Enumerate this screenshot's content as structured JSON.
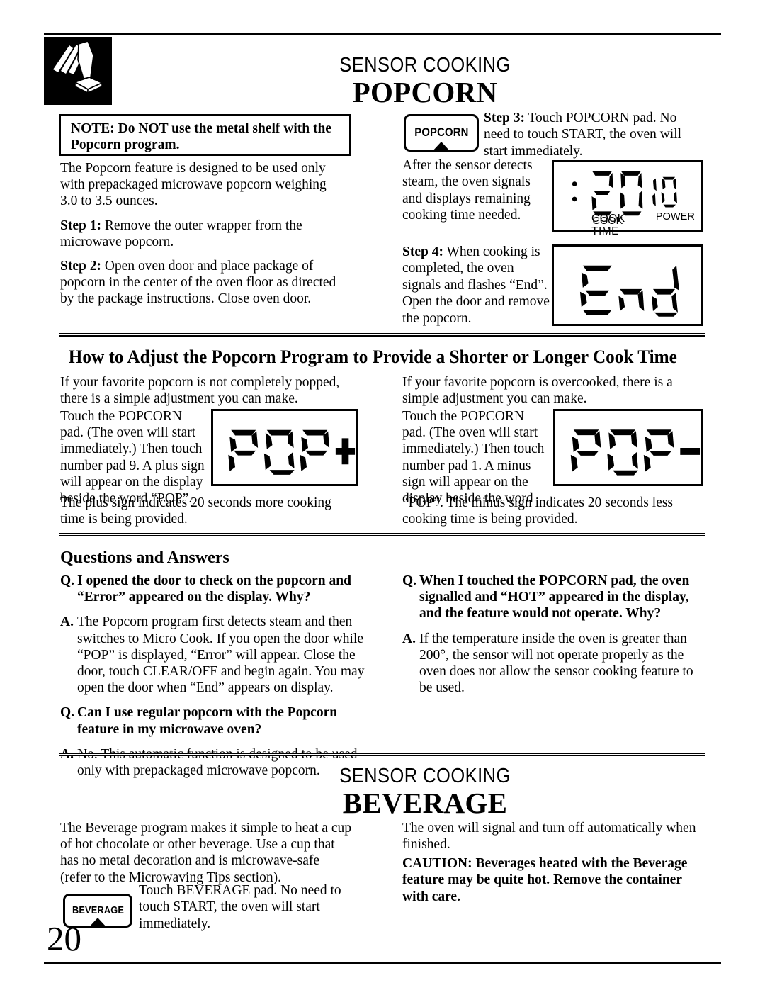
{
  "page": {
    "number": "20",
    "header_icon": "hand-press-icon"
  },
  "popcorn_section": {
    "eyebrow": "SENSOR COOKING",
    "title": "POPCORN",
    "note_line1": "NOTE: Do NOT use the metal shelf with the",
    "note_line2": "Popcorn program.",
    "intro": "The Popcorn feature is designed to be used only with prepackaged microwave popcorn weighing 3.0 to 3.5 ounces.",
    "step1": "Step 1:",
    "step1_text": " Remove the outer wrapper from the microwave popcorn.",
    "step2": "Step 2:",
    "step2_text": " Open oven door and place package of popcorn in the center of the oven floor as directed by the package instructions. Close oven door.",
    "pad_popcorn_label": "POPCORN",
    "step3": "Step 3:",
    "step3_text": " Touch POPCORN pad. No need to touch START, the oven will start immediately.",
    "sensor_detect_text": "After the sensor detects steam, the oven signals and displays remaining cooking time needed.",
    "step4": "Step 4:",
    "step4_text": " When cooking is completed, the oven signals and flashes “End”. Open the door and remove the popcorn."
  },
  "displays": {
    "cook_time": {
      "name": "cook-time-display",
      "big_digits": "20",
      "small_digits": "10",
      "power_label": "POWER",
      "cook_label": "COOK",
      "time_label": "TIME",
      "colon": ":"
    },
    "end": {
      "name": "end-display",
      "text": "End"
    },
    "pop_plus": {
      "name": "pop-plus-display",
      "text": "POP+"
    },
    "pop_minus": {
      "name": "pop-minus-display",
      "text": "POP-"
    }
  },
  "adjust_section": {
    "heading": "How to Adjust the Popcorn Program to Provide a Shorter or Longer Cook Time",
    "left_intro": "If your favorite popcorn is not completely popped, there is a simple adjustment you can make.",
    "left_body": "Touch the POPCORN pad. (The oven will start immediately.) Then touch number pad 9. A plus sign will appear on the display beside the word “POP”.",
    "left_tail": "The plus sign indicates 20 seconds more cooking time is being provided.",
    "right_intro": "If your favorite popcorn is overcooked, there is a simple adjustment you can make.",
    "right_body": "Touch the POPCORN pad. (The oven will start immediately.) Then touch number pad 1. A minus sign will appear on the display beside the word",
    "right_tail": "“POP”. The minus sign indicates 20 seconds less cooking time is being provided."
  },
  "qa_section": {
    "heading": "Questions and Answers",
    "left": [
      {
        "marker": "Q.",
        "type": "question",
        "text": "I opened the door to check on the popcorn and “Error” appeared on the display. Why?"
      },
      {
        "marker": "A.",
        "type": "answer",
        "text": "The Popcorn program first detects steam and then switches to Micro Cook. If you open the door while “POP” is displayed, “Error” will appear. Close the door, touch CLEAR/OFF and begin again. You may open the door when “End” appears on display."
      },
      {
        "marker": "Q.",
        "type": "question",
        "text": "Can I use regular popcorn with the Popcorn feature in my microwave oven?"
      },
      {
        "marker": "A.",
        "type": "answer",
        "text": "No. This automatic function is designed to be used only with prepackaged microwave popcorn."
      }
    ],
    "right": [
      {
        "marker": "Q.",
        "type": "question",
        "text": "When I touched the POPCORN pad, the oven signalled and “HOT” appeared in the display, and the feature would not operate. Why?"
      },
      {
        "marker": "A.",
        "type": "answer",
        "text": "If the temperature inside the oven is greater than 200°, the sensor will not operate properly as the oven does not allow the sensor cooking feature to be used."
      }
    ]
  },
  "beverage_section": {
    "eyebrow": "SENSOR COOKING",
    "title": "BEVERAGE",
    "left_text": "The Beverage program makes it simple to heat a cup of hot chocolate or other beverage. Use a cup that has no metal decoration and is microwave-safe (refer to the Microwaving Tips section).",
    "right_text": "The oven will signal and turn off automatically when finished.",
    "pad_beverage_label": "BEVERAGE",
    "pad_text": "Touch BEVERAGE pad. No need to touch START, the oven will start immediately.",
    "caution": "CAUTION: Beverages heated with the Beverage feature may be quite hot. Remove the container with care."
  },
  "colors": {
    "ink": "#000000",
    "paper": "#ffffff"
  }
}
